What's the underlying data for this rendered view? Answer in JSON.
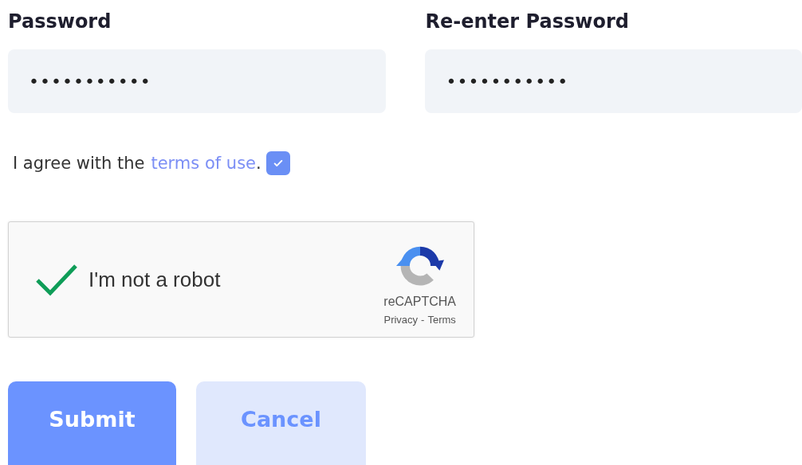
{
  "fields": [
    {
      "label": "Password",
      "value": "•••••••••••"
    },
    {
      "label": "Re-enter Password",
      "value": "•••••••••••"
    }
  ],
  "agreement": {
    "text": "I agree with the",
    "link": "terms of use",
    "after": ".",
    "checked": true
  },
  "captcha": {
    "label": "I'm not a robot",
    "checked": true,
    "brand": "reCAPTCHA",
    "privacy": "Privacy",
    "separator": "-",
    "terms": "Terms"
  },
  "buttons": [
    {
      "label": "Submit",
      "kind": "primary"
    },
    {
      "label": "Cancel",
      "kind": "secondary"
    }
  ]
}
